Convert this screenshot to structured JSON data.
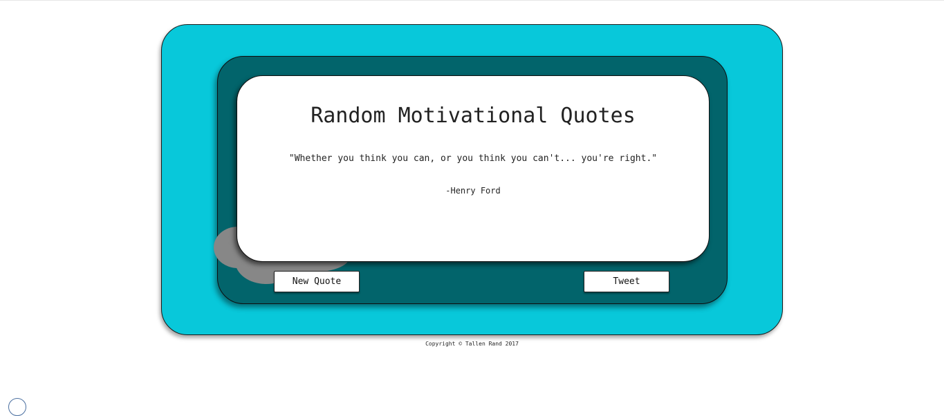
{
  "header": {
    "title": "Random Motivational Quotes"
  },
  "quote": {
    "text": "\"Whether you think you can, or you think you can't... you're right.\"",
    "author": "-Henry Ford"
  },
  "actions": {
    "new_quote_label": "New Quote",
    "tweet_label": "Tweet"
  },
  "footer": {
    "copyright": "Copyright © Tallen Rand 2017"
  },
  "colors": {
    "outer_panel": "#08c8da",
    "inner_panel": "#02646b",
    "card": "#ffffff",
    "cloud_decoration": "#878787"
  }
}
